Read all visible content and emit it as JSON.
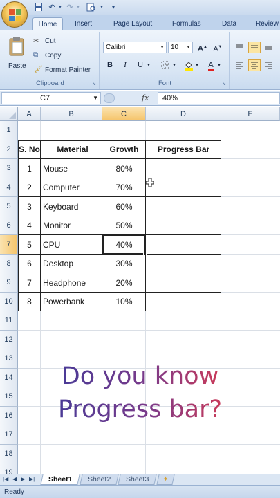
{
  "quick_access": {
    "icons": [
      "save-icon",
      "undo-icon",
      "redo-icon",
      "print-preview-icon",
      "customize-icon"
    ]
  },
  "tabs": [
    "Home",
    "Insert",
    "Page Layout",
    "Formulas",
    "Data",
    "Review"
  ],
  "ribbon": {
    "clipboard": {
      "paste_label": "Paste",
      "cut_label": "Cut",
      "copy_label": "Copy",
      "format_painter_label": "Format Painter",
      "group_label": "Clipboard"
    },
    "font": {
      "font_name": "Calibri",
      "font_size": "10",
      "bold": "B",
      "italic": "I",
      "underline": "U",
      "grow": "A",
      "shrink": "A",
      "font_color": "A",
      "group_label": "Font"
    }
  },
  "formula_bar": {
    "name_box": "C7",
    "fx": "fx",
    "formula": "40%"
  },
  "columns": [
    "A",
    "B",
    "C",
    "D",
    "E"
  ],
  "rows": [
    "1",
    "2",
    "3",
    "4",
    "5",
    "6",
    "7",
    "8",
    "9",
    "10",
    "11",
    "12",
    "13",
    "14",
    "15",
    "16",
    "17",
    "18",
    "19"
  ],
  "table": {
    "headers": [
      "S. No",
      "Material",
      "Growth",
      "Progress Bar"
    ],
    "rows": [
      [
        "1",
        "Mouse",
        "80%",
        ""
      ],
      [
        "2",
        "Computer",
        "70%",
        ""
      ],
      [
        "3",
        "Keyboard",
        "60%",
        ""
      ],
      [
        "4",
        "Monitor",
        "50%",
        ""
      ],
      [
        "5",
        "CPU",
        "40%",
        ""
      ],
      [
        "6",
        "Desktop",
        "30%",
        ""
      ],
      [
        "7",
        "Headphone",
        "20%",
        ""
      ],
      [
        "8",
        "Powerbank",
        "10%",
        ""
      ]
    ]
  },
  "overlay": {
    "line1": "Do you know",
    "line2": "Progress bar?"
  },
  "sheets": [
    "Sheet1",
    "Sheet2",
    "Sheet3"
  ],
  "status": "Ready",
  "colors": {
    "accent_selection": "#f5c46a",
    "overlay_text_start": "#4a3a96",
    "overlay_text_end": "#c83a5a"
  }
}
